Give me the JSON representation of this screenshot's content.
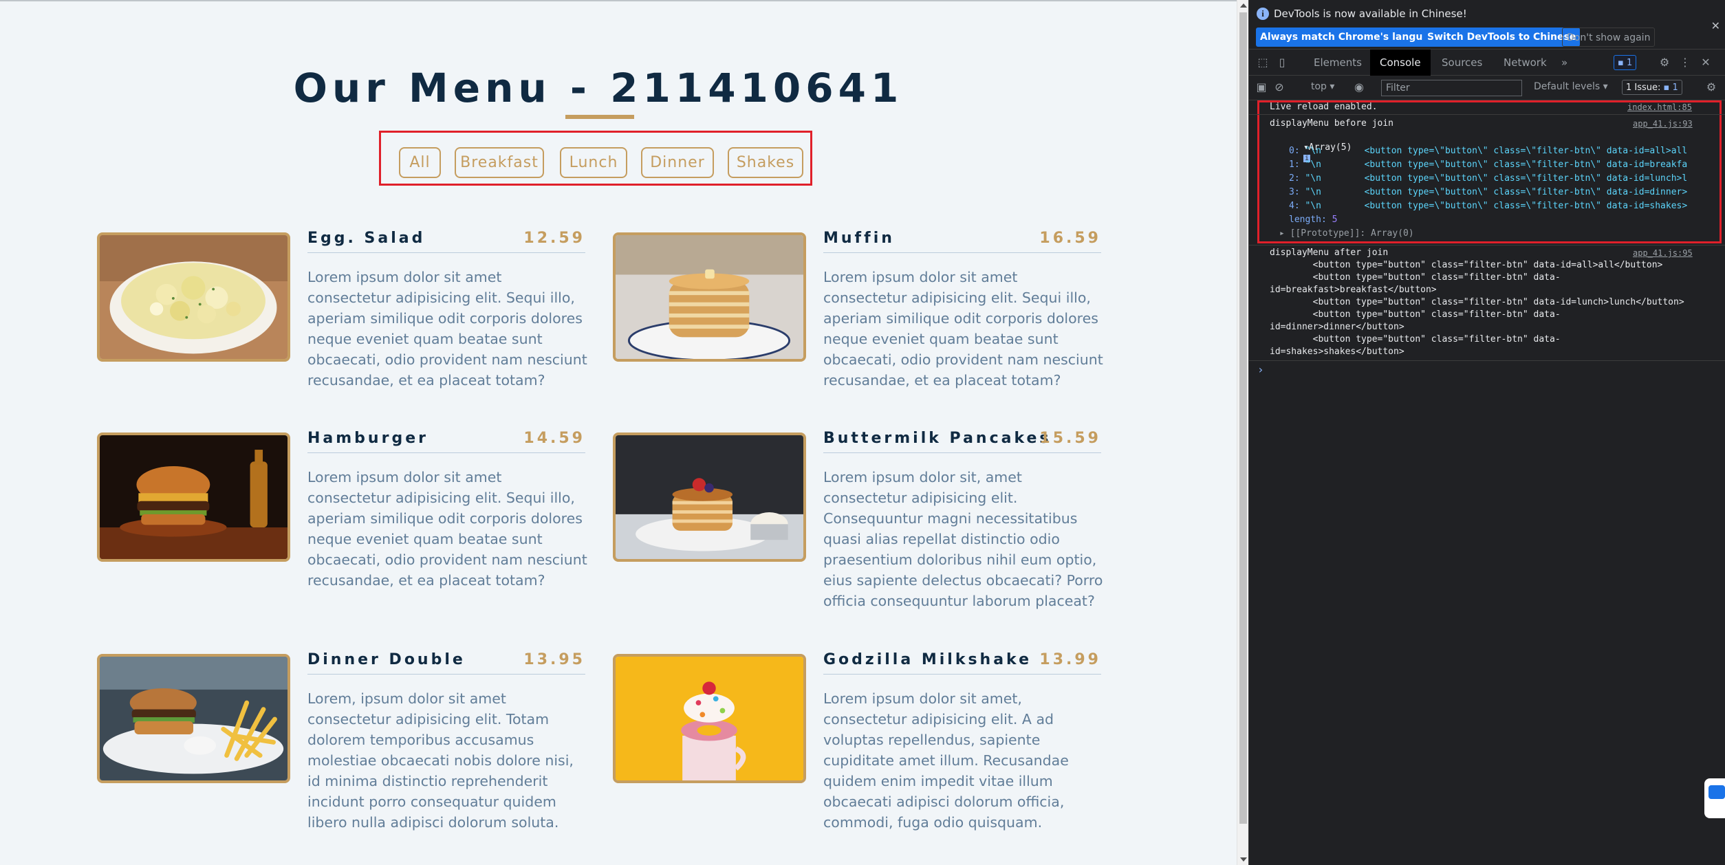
{
  "page": {
    "title": "Our Menu - 211410641",
    "filters": [
      "All",
      "Breakfast",
      "Lunch",
      "Dinner",
      "Shakes"
    ],
    "items": [
      {
        "name": "Egg. Salad",
        "price": "12.59",
        "image": "egg-salad-photo",
        "desc": "Lorem ipsum dolor sit amet consectetur adipisicing elit. Sequi illo, aperiam similique odit corporis dolores neque eveniet quam beatae sunt obcaecati, odio provident nam nesciunt recusandae, et ea placeat totam?"
      },
      {
        "name": "Muffin",
        "price": "16.59",
        "image": "pancake-stack-photo",
        "desc": "Lorem ipsum dolor sit amet consectetur adipisicing elit. Sequi illo, aperiam similique odit corporis dolores neque eveniet quam beatae sunt obcaecati, odio provident nam nesciunt recusandae, et ea placeat totam?"
      },
      {
        "name": "Hamburger",
        "price": "14.59",
        "image": "hamburger-photo",
        "desc": "Lorem ipsum dolor sit amet consectetur adipisicing elit. Sequi illo, aperiam similique odit corporis dolores neque eveniet quam beatae sunt obcaecati, odio provident nam nesciunt recusandae, et ea placeat totam?"
      },
      {
        "name": "Buttermilk Pancakes",
        "price": "15.59",
        "image": "pancakes-photo",
        "desc": "Lorem ipsum dolor sit, amet consectetur adipisicing elit. Consequuntur magni necessitatibus quasi alias repellat distinctio odio praesentium doloribus nihil eum optio, eius sapiente delectus obcaecati? Porro officia consequuntur laborum placeat?"
      },
      {
        "name": "Dinner Double",
        "price": "13.95",
        "image": "burger-fries-photo",
        "desc": "Lorem, ipsum dolor sit amet consectetur adipisicing elit. Totam dolorem temporibus accusamus molestiae obcaecati nobis dolore nisi, id minima distinctio reprehenderit incidunt porro consequatur quidem libero nulla adipisci dolorum soluta."
      },
      {
        "name": "Godzilla Milkshake",
        "price": "13.99",
        "image": "milkshake-photo",
        "desc": "Lorem ipsum dolor sit amet, consectetur adipisicing elit. A ad voluptas repellendus, sapiente cupiditate amet illum. Recusandae quidem enim impedit vitae illum obcaecati adipisci dolorum officia, commodi, fuga odio quisquam."
      }
    ]
  },
  "devtools": {
    "infobar": {
      "message": "DevTools is now available in Chinese!",
      "btn_match": "Always match Chrome's language",
      "btn_switch": "Switch DevTools to Chinese",
      "btn_dismiss": "Don't show again"
    },
    "tabs": {
      "elements": "Elements",
      "console": "Console",
      "sources": "Sources",
      "network": "Network",
      "more": "»",
      "messages_badge": "1"
    },
    "toolbar": {
      "context": "top",
      "filter_placeholder": "Filter",
      "levels": "Default levels",
      "issues_label": "1 Issue:",
      "issues_count": "1"
    },
    "console": {
      "live_reload": "Live reload enabled.",
      "live_reload_src": "index.html:85",
      "before_label": "displayMenu before join",
      "before_src": "app_41.js:93",
      "array_label": "Array(5)",
      "array_rows": [
        {
          "index": "0:",
          "value": "\"\\n        <button type=\\\"button\\\" class=\\\"filter-btn\\\" data-id=all>all"
        },
        {
          "index": "1:",
          "value": "\"\\n        <button type=\\\"button\\\" class=\\\"filter-btn\\\" data-id=breakfa"
        },
        {
          "index": "2:",
          "value": "\"\\n        <button type=\\\"button\\\" class=\\\"filter-btn\\\" data-id=lunch>l"
        },
        {
          "index": "3:",
          "value": "\"\\n        <button type=\\\"button\\\" class=\\\"filter-btn\\\" data-id=dinner>"
        },
        {
          "index": "4:",
          "value": "\"\\n        <button type=\\\"button\\\" class=\\\"filter-btn\\\" data-id=shakes>"
        }
      ],
      "length_key": "length:",
      "length_val": "5",
      "prototype": "[[Prototype]]: Array(0)",
      "after_label": "displayMenu after join",
      "after_src": "app_41.js:95",
      "after_lines": [
        "        <button type=\"button\" class=\"filter-btn\" data-id=all>all</button>",
        "        <button type=\"button\" class=\"filter-btn\" data-",
        "id=breakfast>breakfast</button>",
        "        <button type=\"button\" class=\"filter-btn\" data-id=lunch>lunch</button>",
        "        <button type=\"button\" class=\"filter-btn\" data-",
        "id=dinner>dinner</button>",
        "        <button type=\"button\" class=\"filter-btn\" data-",
        "id=shakes>shakes</button>"
      ],
      "prompt": "›"
    }
  }
}
